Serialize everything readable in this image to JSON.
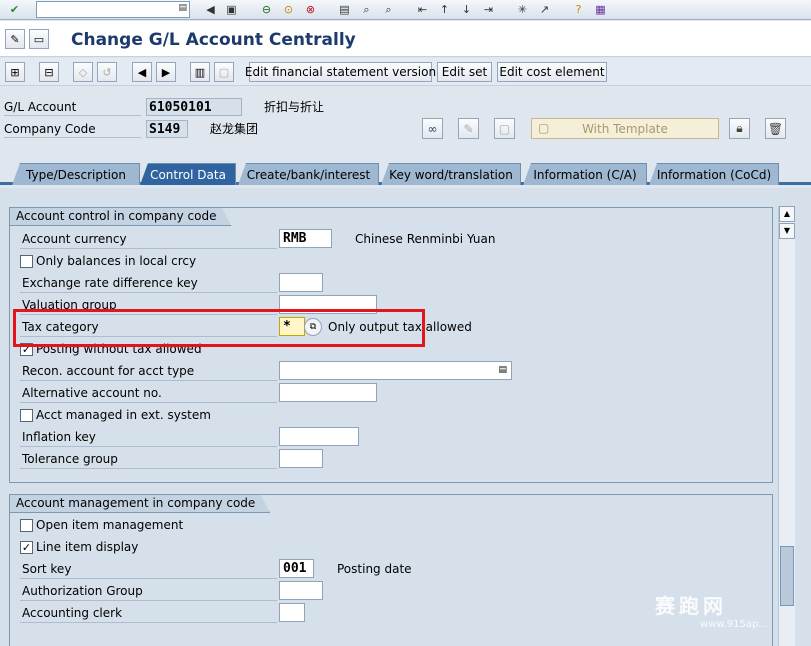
{
  "window": {
    "title": "Change G/L Account Centrally"
  },
  "system_toolbar": {
    "icons": [
      "enter-icon",
      "save-icon",
      "back-icon",
      "exit-icon",
      "cancel-icon",
      "print-icon",
      "find-icon",
      "find-next-icon",
      "first-page-icon",
      "previous-page-icon",
      "next-page-icon",
      "last-page-icon",
      "new-session-icon",
      "shortcut-icon",
      "help-icon",
      "layout-menu-icon"
    ]
  },
  "app_toolbar": {
    "buttons": {
      "edit_fs_version": "Edit financial statement version",
      "edit_set": "Edit set",
      "edit_cost_element": "Edit cost element"
    }
  },
  "header": {
    "gl_account_label": "G/L Account",
    "gl_account_value": "61050101",
    "gl_account_desc": "折扣与折让",
    "company_code_label": "Company Code",
    "company_code_value": "S149",
    "company_code_desc": "赵龙集团",
    "with_template_label": "With Template"
  },
  "tabs": [
    {
      "label": "Type/Description",
      "active": false
    },
    {
      "label": "Control Data",
      "active": true
    },
    {
      "label": "Create/bank/interest",
      "active": false
    },
    {
      "label": "Key word/translation",
      "active": false
    },
    {
      "label": "Information (C/A)",
      "active": false
    },
    {
      "label": "Information (CoCd)",
      "active": false
    }
  ],
  "account_control": {
    "title": "Account control in company code",
    "account_currency_label": "Account currency",
    "account_currency_value": "RMB",
    "account_currency_desc": "Chinese Renminbi Yuan",
    "only_balances_label": "Only balances in local crcy",
    "only_balances_checked": false,
    "exchange_rate_label": "Exchange rate difference key",
    "valuation_group_label": "Valuation group",
    "tax_category_label": "Tax category",
    "tax_category_value": "*",
    "tax_category_desc": "Only output tax allowed",
    "posting_without_tax_label": "Posting without tax allowed",
    "posting_without_tax_checked": true,
    "recon_account_label": "Recon. account for acct type",
    "alternative_account_label": "Alternative account no.",
    "acct_managed_label": "Acct managed in ext. system",
    "acct_managed_checked": false,
    "inflation_key_label": "Inflation key",
    "tolerance_group_label": "Tolerance group"
  },
  "account_management": {
    "title": "Account management in company code",
    "open_item_label": "Open item management",
    "open_item_checked": false,
    "line_item_label": "Line item display",
    "line_item_checked": true,
    "sort_key_label": "Sort key",
    "sort_key_value": "001",
    "sort_key_desc": "Posting date",
    "authorization_group_label": "Authorization Group",
    "accounting_clerk_label": "Accounting clerk"
  },
  "watermark": {
    "text": "赛跑网",
    "url": "www.915ap..."
  },
  "colors": {
    "highlight": "#e3141b",
    "active_tab": "#2f64a0",
    "title": "#1c3a6b"
  }
}
